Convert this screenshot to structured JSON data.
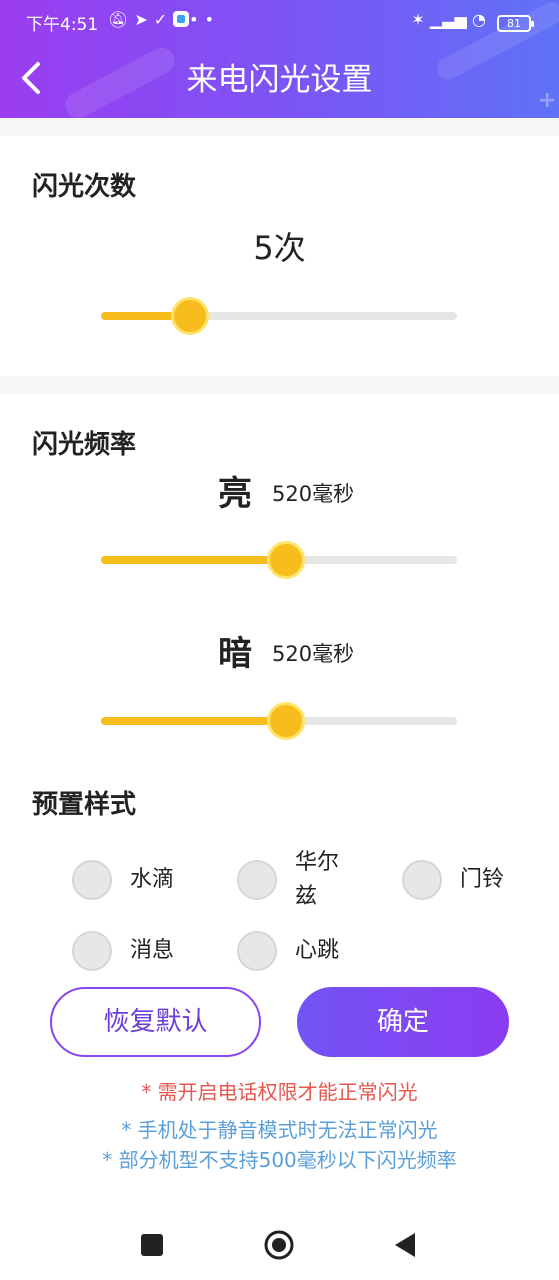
{
  "status_bar": {
    "time": "下午4:51",
    "battery": "81"
  },
  "header": {
    "title": "来电闪光设置"
  },
  "flash_count": {
    "section_title": "闪光次数",
    "value_text": "5次",
    "slider_fraction": 0.25
  },
  "flash_frequency": {
    "section_title": "闪光频率",
    "bright": {
      "label": "亮",
      "value_text": "520毫秒",
      "slider_fraction": 0.52
    },
    "dark": {
      "label": "暗",
      "value_text": "520毫秒",
      "slider_fraction": 0.52
    }
  },
  "presets": {
    "section_title": "预置样式",
    "items": [
      {
        "label": "水滴"
      },
      {
        "label": "华尔兹"
      },
      {
        "label": "门铃"
      },
      {
        "label": "消息"
      },
      {
        "label": "心跳"
      }
    ]
  },
  "buttons": {
    "reset_label": "恢复默认",
    "confirm_label": "确定"
  },
  "notes": {
    "permission": "* 需开启电话权限才能正常闪光",
    "silent_mode": "* 手机处于静音模式时无法正常闪光",
    "frequency_limit": "* 部分机型不支持500毫秒以下闪光频率"
  },
  "colors": {
    "accent_yellow": "#f7bd1c",
    "header_start": "#9b3df0",
    "header_end": "#5f72f7",
    "note_red": "#e6574e",
    "note_blue": "#5b9fd9"
  },
  "icons": {
    "back": "chevron-left-icon",
    "nav_recents": "square-icon",
    "nav_home": "circle-icon",
    "nav_back": "triangle-left-icon"
  }
}
